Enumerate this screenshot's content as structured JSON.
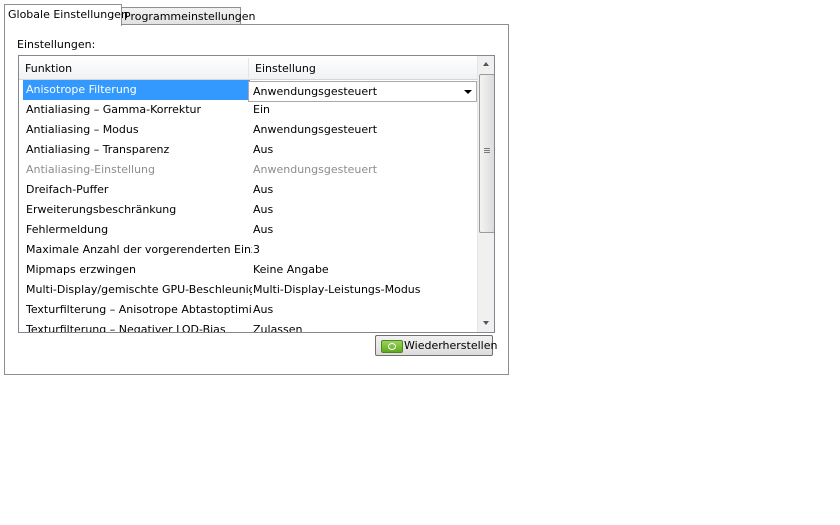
{
  "tabs": [
    {
      "label": "Globale Einstellungen"
    },
    {
      "label": "Programmeinstellungen"
    }
  ],
  "panel": {
    "group_label": "Einstellungen:",
    "columns": [
      "Funktion",
      "Einstellung"
    ],
    "rows": [
      {
        "feature": "Anisotrope Filterung",
        "setting": "Anwendungsgesteuert",
        "state": "selected"
      },
      {
        "feature": "Antialiasing – Gamma-Korrektur",
        "setting": "Ein",
        "state": "normal"
      },
      {
        "feature": "Antialiasing – Modus",
        "setting": "Anwendungsgesteuert",
        "state": "normal"
      },
      {
        "feature": "Antialiasing – Transparenz",
        "setting": "Aus",
        "state": "normal"
      },
      {
        "feature": "Antialiasing-Einstellung",
        "setting": "Anwendungsgesteuert",
        "state": "disabled"
      },
      {
        "feature": "Dreifach-Puffer",
        "setting": "Aus",
        "state": "normal"
      },
      {
        "feature": "Erweiterungsbeschränkung",
        "setting": "Aus",
        "state": "normal"
      },
      {
        "feature": "Fehlermeldung",
        "setting": "Aus",
        "state": "normal"
      },
      {
        "feature": "Maximale Anzahl der vorgerenderten Einz…",
        "setting": "3",
        "state": "normal"
      },
      {
        "feature": "Mipmaps erzwingen",
        "setting": "Keine Angabe",
        "state": "normal"
      },
      {
        "feature": "Multi-Display/gemischte GPU-Beschleunigung",
        "setting": "Multi-Display-Leistungs-Modus",
        "state": "normal"
      },
      {
        "feature": "Texturfilterung – Anisotrope Abtastoptimi…",
        "setting": "Aus",
        "state": "normal"
      },
      {
        "feature": "Texturfilterung – Negativer LOD-Bias",
        "setting": "Zulassen",
        "state": "normal"
      }
    ],
    "restore_button": "Wiederherstellen"
  },
  "icons": {
    "dropdown": "chevron-down-icon",
    "scroll_up": "scroll-up-arrow-icon",
    "scroll_down": "scroll-down-arrow-icon",
    "restore": "nvidia-logo-icon"
  },
  "colors": {
    "selection": "#3399ff",
    "disabled_text": "#8d8d8d"
  }
}
